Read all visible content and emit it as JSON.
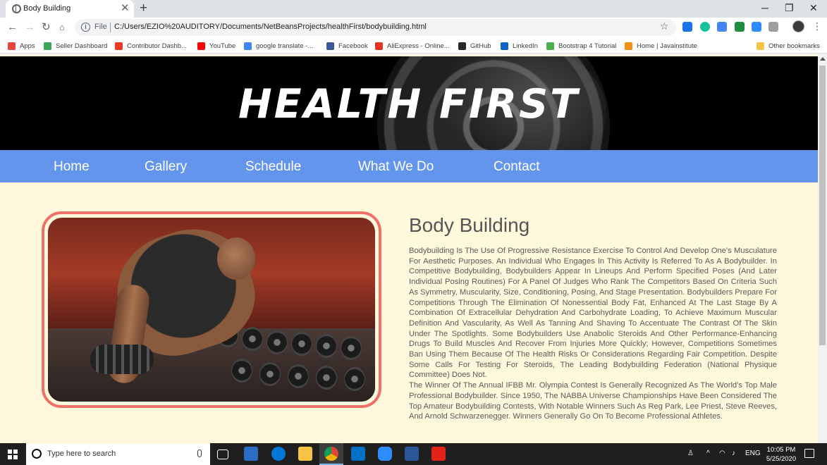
{
  "browser": {
    "tab_title": "Body Building",
    "tab_close": "✕",
    "new_tab": "+",
    "window_minimize": "─",
    "window_maximize": "❐",
    "window_close": "✕",
    "file_label": "File",
    "url": "C:/Users/EZIO%20AUDITORY/Documents/NetBeansProjects/healthFirst/bodybuilding.html",
    "bookmarks": [
      {
        "label": "Apps",
        "color": "#e8453c",
        "icon": "apps-grid-icon"
      },
      {
        "label": "Seller Dashboard",
        "color": "#3aa757",
        "icon": "seller-dashboard-icon"
      },
      {
        "label": "Contributor Dashb...",
        "color": "#ee3a25",
        "icon": "contributor-icon"
      },
      {
        "label": "YouTube",
        "color": "#ff0000",
        "icon": "youtube-icon"
      },
      {
        "label": "google translate -...",
        "color": "#4285f4",
        "icon": "google-icon"
      },
      {
        "label": "Facebook",
        "color": "#3b5998",
        "icon": "facebook-icon"
      },
      {
        "label": "AliExpress - Online...",
        "color": "#e43225",
        "icon": "aliexpress-icon"
      },
      {
        "label": "GitHub",
        "color": "#24292e",
        "icon": "github-icon"
      },
      {
        "label": "LinkedIn",
        "color": "#0a66c2",
        "icon": "linkedin-icon"
      },
      {
        "label": "Bootstrap 4 Tutorial",
        "color": "#4caf50",
        "icon": "bootstrap-icon"
      },
      {
        "label": "Home | Javainstitute",
        "color": "#f29111",
        "icon": "javainstitute-icon"
      },
      {
        "label": "Other bookmarks",
        "color": "#f5c445",
        "icon": "folder-icon"
      }
    ]
  },
  "page": {
    "banner_title": "HEALTH  FIRST",
    "nav": [
      "Home",
      "Gallery",
      "Schedule",
      "What We Do",
      "Contact"
    ],
    "heading": "Body Building",
    "paragraph_1": "Bodybuilding is the use of progressive resistance exercise to control and develop one's musculature for aesthetic purposes. An individual who engages in this activity is referred to as a bodybuilder. In competitive bodybuilding, bodybuilders appear in lineups and perform specified poses (and later individual posing routines) for a panel of judges who rank the competitors based on criteria such as symmetry, muscularity, size, conditioning, posing, and stage presentation. Bodybuilders prepare for competitions through the elimination of nonessential body fat, enhanced at the last stage by a combination of extracellular dehydration and carbohydrate loading, to achieve maximum muscular definition and vascularity, as well as tanning and shaving to accentuate the contrast of the skin under the spotlights. Some bodybuilders use anabolic steroids and other performance-enhancing drugs to build muscles and recover from injuries more quickly; however, competitions sometimes ban using them because of the health risks or considerations regarding fair competition. Despite some calls for testing for steroids, the leading bodybuilding federation (National Physique Committee) does not.",
    "paragraph_2": "The winner of the annual IFBB Mr. Olympia contest is generally recognized as the world's top male professional bodybuilder. Since 1950, the NABBA Universe Championships have been considered the top amateur bodybuilding contests, with notable winners such as Reg Park, Lee Priest, Steve Reeves, and Arnold Schwarzenegger. Winners generally go on to become professional athletes."
  },
  "taskbar": {
    "search_placeholder": "Type here to search",
    "language": "ENG",
    "time": "10:05 PM",
    "date": "5/25/2020"
  },
  "colors": {
    "nav_bg": "#6495ed",
    "page_bg": "#fff8dc",
    "photo_border": "#f07067"
  }
}
